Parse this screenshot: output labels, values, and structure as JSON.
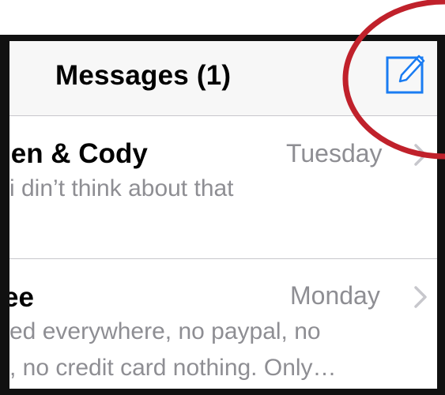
{
  "nav": {
    "title": "Messages (1)",
    "compose_icon": "compose-icon"
  },
  "conversations": [
    {
      "sender": "ien & Cody",
      "time": "Tuesday",
      "preview_lines": [
        "i din’t think about that"
      ]
    },
    {
      "sender": "ee",
      "time": "Monday",
      "preview_lines": [
        "ed everywhere, no paypal, no",
        ", no credit card nothing. Only…"
      ]
    }
  ],
  "colors": {
    "accent": "#1a7cf2",
    "annotation": "#c0212b",
    "secondary_text": "#8e8e93",
    "separator": "#c8c7cc"
  }
}
